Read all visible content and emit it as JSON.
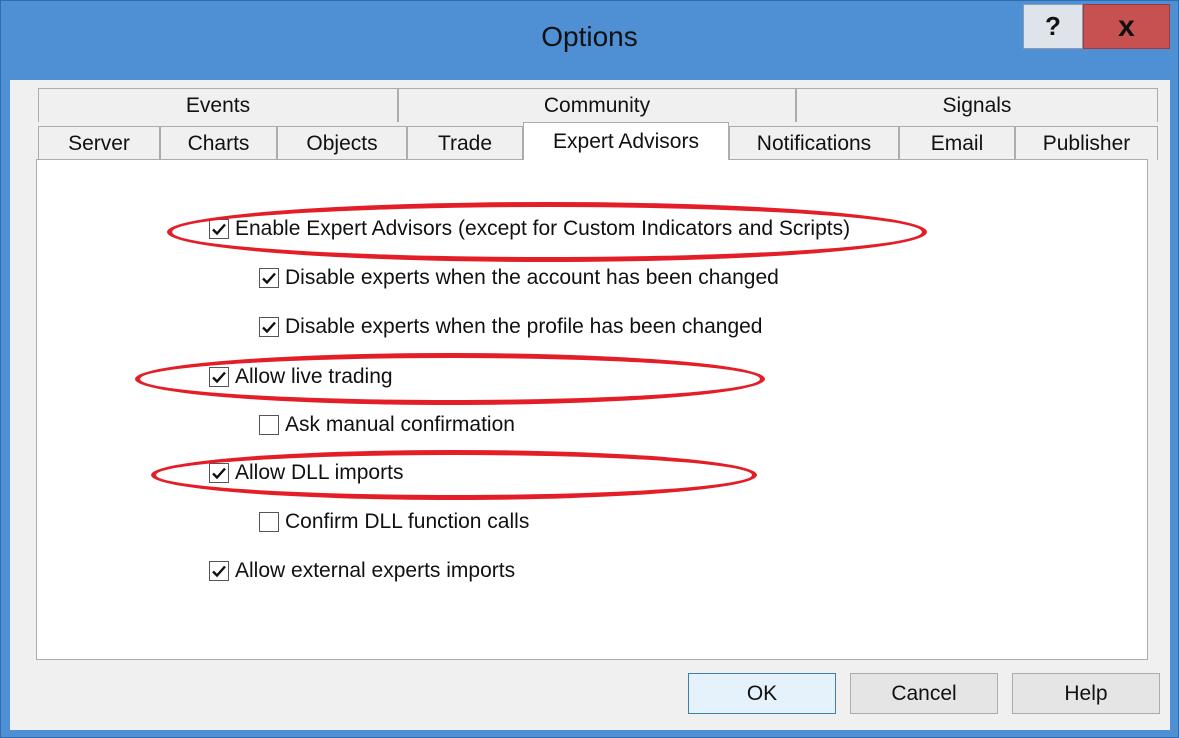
{
  "window": {
    "title": "Options",
    "help_glyph": "?",
    "close_glyph": "x"
  },
  "tabs": {
    "top_row": [
      "Events",
      "Community",
      "Signals"
    ],
    "bottom_row": [
      "Server",
      "Charts",
      "Objects",
      "Trade",
      "Expert Advisors",
      "Notifications",
      "Email",
      "Publisher"
    ],
    "active": "Expert Advisors"
  },
  "options": [
    {
      "label": "Enable Expert Advisors (except for Custom Indicators and Scripts)",
      "checked": true,
      "highlighted": true
    },
    {
      "label": "Disable experts when the account has been changed",
      "checked": true,
      "highlighted": false
    },
    {
      "label": "Disable experts when the profile has been changed",
      "checked": true,
      "highlighted": false
    },
    {
      "label": "Allow live trading",
      "checked": true,
      "highlighted": true
    },
    {
      "label": "Ask manual confirmation",
      "checked": false,
      "highlighted": false
    },
    {
      "label": "Allow DLL imports",
      "checked": true,
      "highlighted": true
    },
    {
      "label": "Confirm DLL function calls",
      "checked": false,
      "highlighted": false
    },
    {
      "label": "Allow external experts imports",
      "checked": true,
      "highlighted": false
    }
  ],
  "buttons": {
    "ok": "OK",
    "cancel": "Cancel",
    "help": "Help"
  },
  "colors": {
    "title_bar": "#4f8fd4",
    "close_button": "#c75050",
    "highlight_ellipse": "#e41e26"
  }
}
